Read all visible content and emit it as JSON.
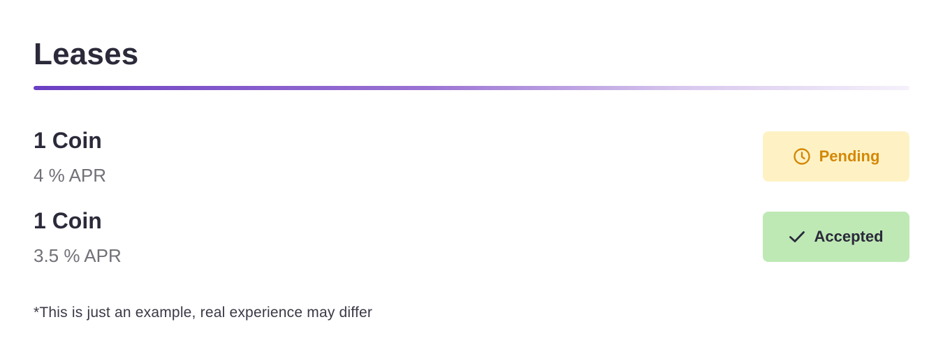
{
  "section": {
    "title": "Leases"
  },
  "colors": {
    "divider_start": "#6b3fc2",
    "divider_end": "#f5f1fb",
    "pending_bg": "#fef2c5",
    "pending_text": "#d48806",
    "accepted_bg": "#bee9b5",
    "accepted_text": "#2b2a3a"
  },
  "leases": [
    {
      "amount": "1 Coin",
      "apr": "4 % APR",
      "status": {
        "label": "Pending",
        "icon": "clock-icon"
      }
    },
    {
      "amount": "1 Coin",
      "apr": "3.5 % APR",
      "status": {
        "label": "Accepted",
        "icon": "checkmark-icon"
      }
    }
  ],
  "footnote": "*This is just an example, real experience may differ"
}
